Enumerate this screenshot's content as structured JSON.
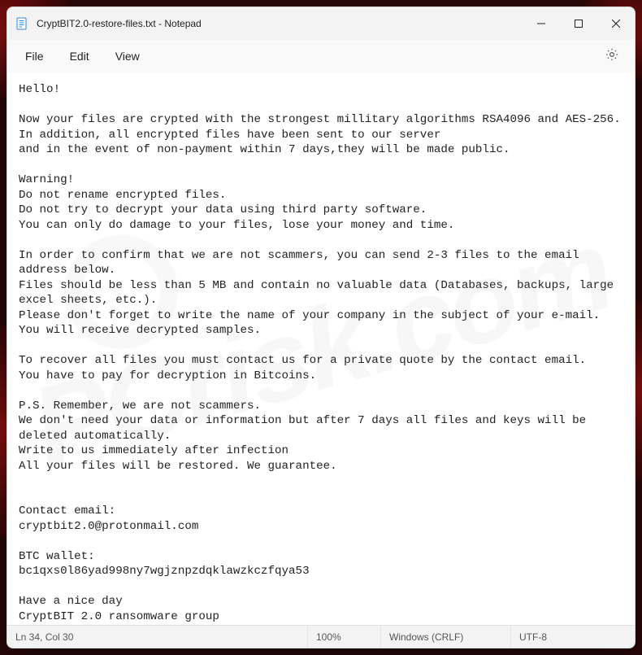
{
  "window": {
    "title": "CryptBIT2.0-restore-files.txt - Notepad"
  },
  "menu": {
    "file": "File",
    "edit": "Edit",
    "view": "View"
  },
  "document": {
    "text": "Hello!\n\nNow your files are crypted with the strongest millitary algorithms RSA4096 and AES-256.\nIn addition, all encrypted files have been sent to our server\nand in the event of non-payment within 7 days,they will be made public.\n\nWarning!\nDo not rename encrypted files.\nDo not try to decrypt your data using third party software.\nYou can only do damage to your files, lose your money and time.\n\nIn order to confirm that we are not scammers, you can send 2-3 files to the email address below.\nFiles should be less than 5 MB and contain no valuable data (Databases, backups, large excel sheets, etc.).\nPlease don't forget to write the name of your company in the subject of your e-mail.\nYou will receive decrypted samples.\n\nTo recover all files you must contact us for a private quote by the contact email.\nYou have to pay for decryption in Bitcoins.\n\nP.S. Remember, we are not scammers.\nWe don't need your data or information but after 7 days all files and keys will be deleted automatically.\nWrite to us immediately after infection\nAll your files will be restored. We guarantee.\n\n\nContact email:\ncryptbit2.0@protonmail.com\n\nBTC wallet:\nbc1qxs0l86yad998ny7wgjznpzdqklawzkczfqya53\n\nHave a nice day\nCryptBIT 2.0 ransomware group"
  },
  "status": {
    "position": "Ln 34, Col 30",
    "zoom": "100%",
    "eol": "Windows (CRLF)",
    "encoding": "UTF-8"
  },
  "watermark": "PCrisk.com"
}
